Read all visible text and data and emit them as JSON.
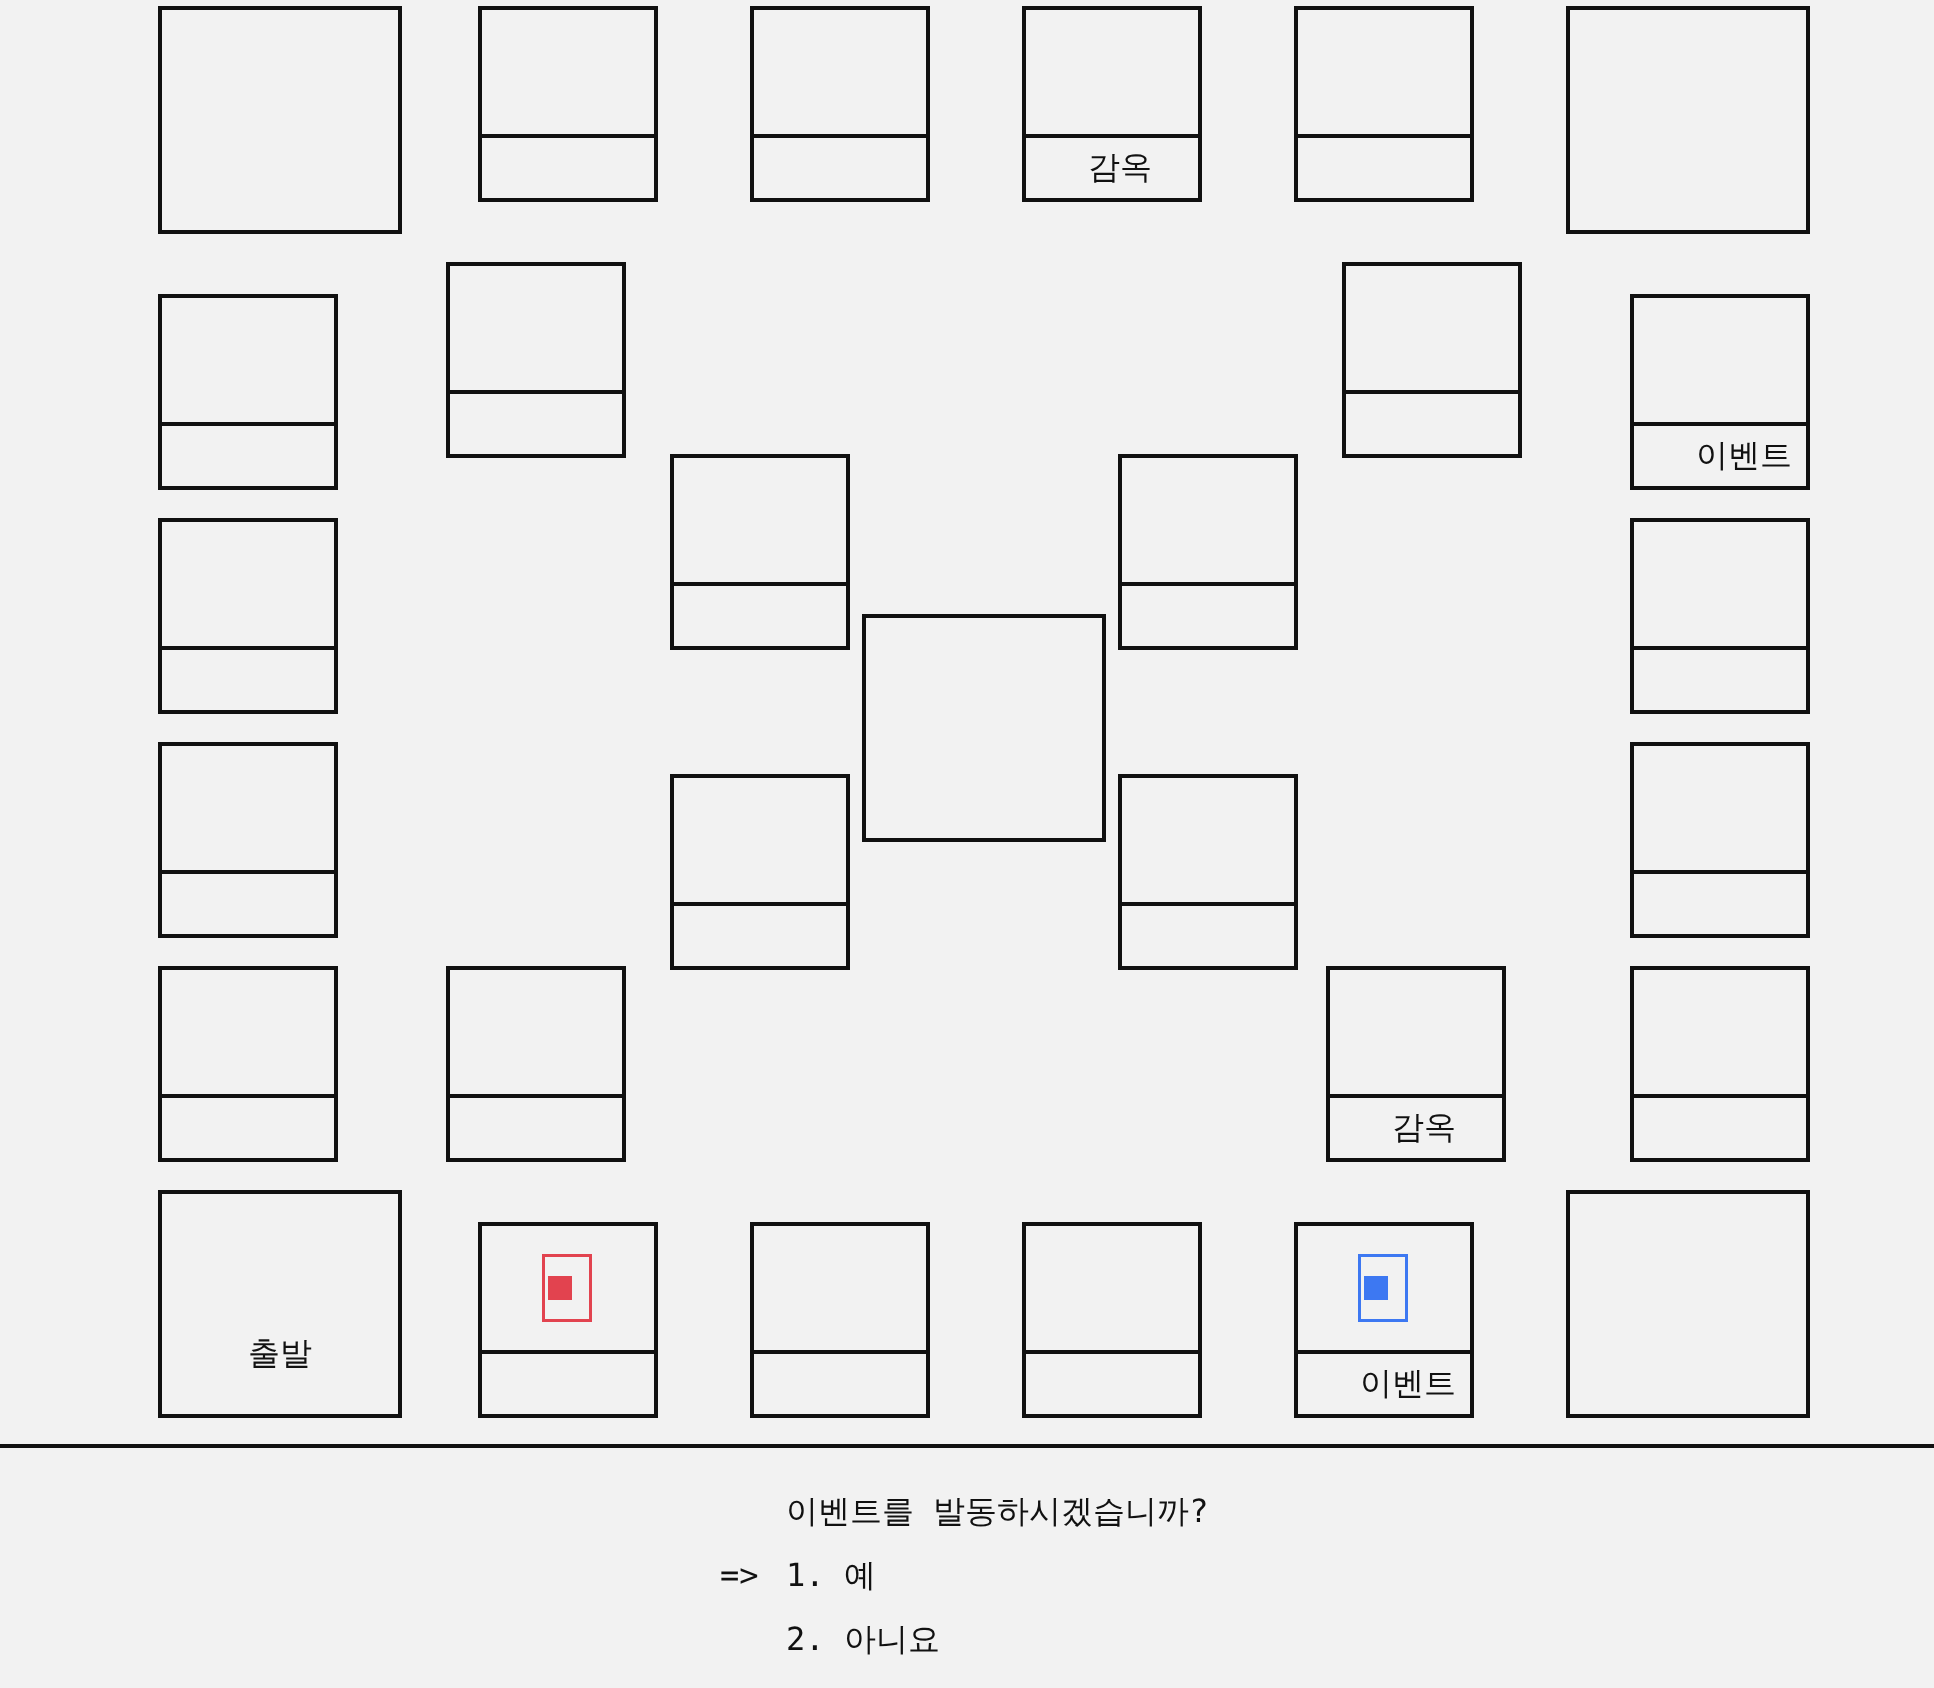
{
  "board": {
    "tiles": [
      {
        "kind": "corner"
      },
      {
        "kind": "space"
      },
      {
        "kind": "space"
      },
      {
        "kind": "space",
        "label": "감옥"
      },
      {
        "kind": "space"
      },
      {
        "kind": "corner"
      },
      {
        "kind": "space"
      },
      {
        "kind": "space"
      },
      {
        "kind": "space"
      },
      {
        "kind": "space",
        "label": "이벤트"
      },
      {
        "kind": "space"
      },
      {
        "kind": "space"
      },
      {
        "kind": "space"
      },
      {
        "kind": "space"
      },
      {
        "kind": "center"
      },
      {
        "kind": "space"
      },
      {
        "kind": "space"
      },
      {
        "kind": "space"
      },
      {
        "kind": "space"
      },
      {
        "kind": "space"
      },
      {
        "kind": "space"
      },
      {
        "kind": "space",
        "label": "감옥"
      },
      {
        "kind": "space"
      },
      {
        "kind": "corner",
        "label": "출발"
      },
      {
        "kind": "space",
        "tokens": [
          {
            "color": "#e2434f"
          }
        ]
      },
      {
        "kind": "space"
      },
      {
        "kind": "space"
      },
      {
        "kind": "space",
        "label": "이벤트",
        "tokens": [
          {
            "color": "#3d78f2"
          }
        ]
      },
      {
        "kind": "corner"
      }
    ]
  },
  "prompt": {
    "question": "이벤트를 발동하시겠습니까?",
    "cursor": "=>",
    "options": [
      {
        "label": "1. 예",
        "selected": true
      },
      {
        "label": "2. 아니요",
        "selected": false
      }
    ]
  }
}
